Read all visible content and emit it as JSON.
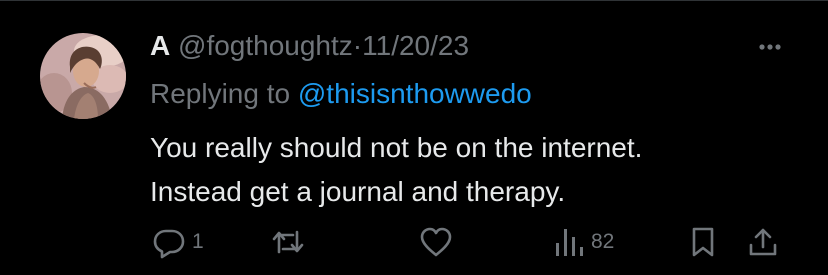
{
  "tweet": {
    "display_name": "A",
    "handle": "@fogthoughtz",
    "separator": "·",
    "date": "11/20/23",
    "reply_prefix": "Replying to",
    "reply_to": "@thisisnthowwedo",
    "text_lines": [
      "You really should not be on the internet.",
      "Instead get a journal and therapy."
    ]
  },
  "actions": {
    "reply_count": "1",
    "retweet_count": "",
    "like_count": "",
    "views_count": "82"
  },
  "icons": {
    "reply": "reply-bubble-icon",
    "retweet": "retweet-arrows-icon",
    "like": "heart-icon",
    "views": "bar-chart-icon",
    "bookmark": "bookmark-icon",
    "share": "share-upload-icon",
    "more": "more-dots-icon"
  },
  "colors": {
    "background": "#000000",
    "primary_text": "#e7e9ea",
    "secondary_text": "#71767b",
    "link": "#1d9bf0"
  }
}
